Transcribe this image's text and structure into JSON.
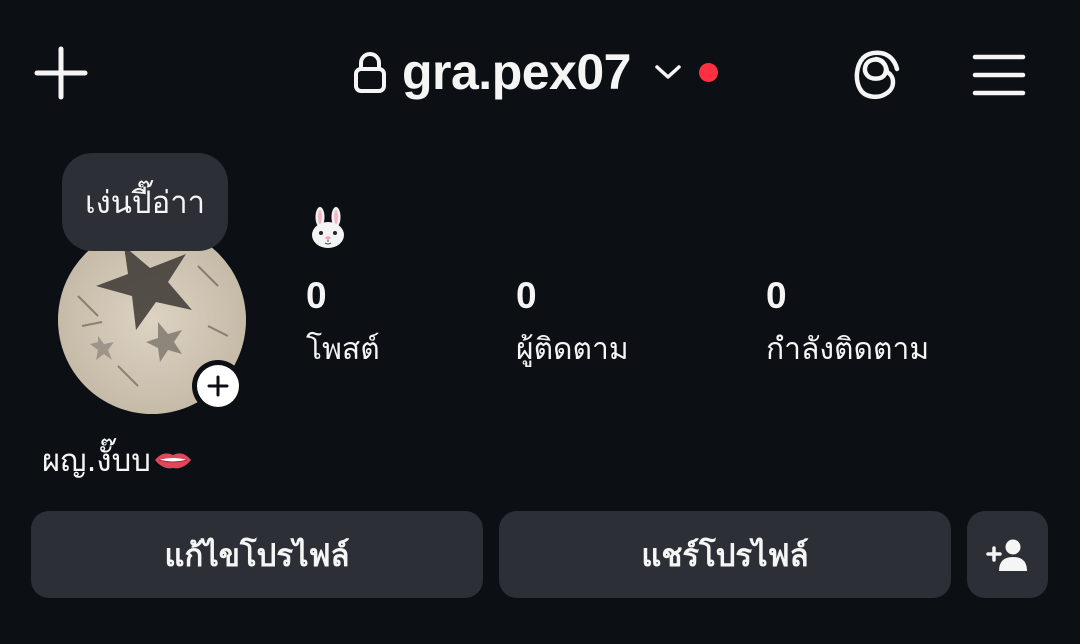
{
  "header": {
    "username": "gra.pex07",
    "icons": {
      "add": "plus-icon",
      "lock": "lock-icon",
      "switch": "chevron-down-icon",
      "threads": "threads-icon",
      "menu": "hamburger-menu-icon"
    },
    "notification_dot_color": "#ff3040"
  },
  "profile": {
    "note": "เง่นปี๊อ่าา",
    "bio_emoji": "rabbit-face",
    "display_name": "ผญ.งั๊บบ",
    "display_name_emoji": "biting-lip",
    "stats": [
      {
        "value": "0",
        "label": "โพสต์"
      },
      {
        "value": "0",
        "label": "ผู้ติดตาม"
      },
      {
        "value": "0",
        "label": "กำลังติดตาม"
      }
    ]
  },
  "actions": {
    "edit_profile": "แก้ไขโปรไฟล์",
    "share_profile": "แชร์โปรไฟล์",
    "add_person_icon": "add-person-icon"
  },
  "colors": {
    "background": "#0c0f14",
    "button_background": "#2c2f35",
    "text": "#f5f5f5"
  }
}
